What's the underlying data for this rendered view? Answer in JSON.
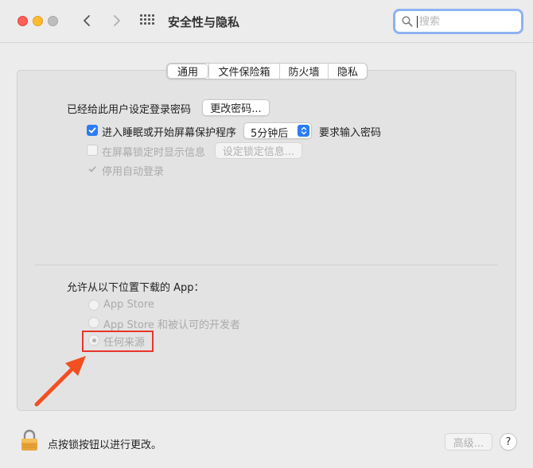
{
  "window": {
    "title": "安全性与隐私"
  },
  "search": {
    "placeholder": "搜索",
    "icon": "magnifier-icon"
  },
  "tabs": [
    {
      "label": "通用",
      "active": true
    },
    {
      "label": "文件保险箱",
      "active": false
    },
    {
      "label": "防火墙",
      "active": false
    },
    {
      "label": "隐私",
      "active": false
    }
  ],
  "general": {
    "password_label": "已经给此用户设定登录密码",
    "change_password_button": "更改密码...",
    "require_password": {
      "label": "进入睡眠或开始屏幕保护程序",
      "checked": true,
      "delay_value": "5分钟后",
      "suffix": "要求输入密码"
    },
    "lock_message": {
      "label": "在屏幕锁定时显示信息",
      "checked": false,
      "enabled": false,
      "button": "设定锁定信息..."
    },
    "disable_auto_login": {
      "label": "停用自动登录",
      "checked": true,
      "enabled": false
    }
  },
  "downloads": {
    "heading": "允许从以下位置下载的 App：",
    "options": [
      {
        "label": "App Store",
        "selected": false
      },
      {
        "label": "App Store 和被认可的开发者",
        "selected": false
      },
      {
        "label": "任何来源",
        "selected": true
      }
    ]
  },
  "footer": {
    "lock_text": "点按锁按钮以进行更改。",
    "advanced_button": "高级...",
    "help_button": "?"
  },
  "colors": {
    "accent": "#2b7cf5",
    "annotation": "#e8352a"
  }
}
